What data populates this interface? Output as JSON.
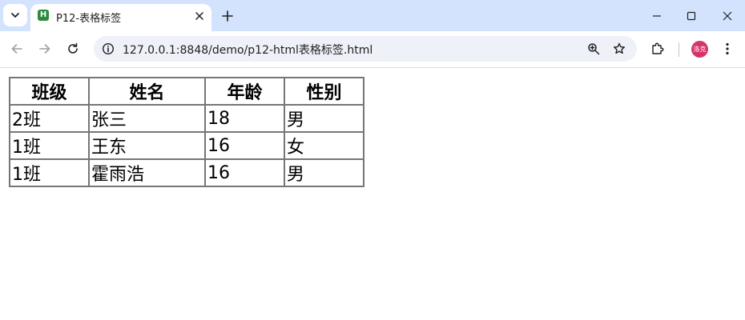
{
  "browser": {
    "tab": {
      "title": "P12-表格标签",
      "favicon_letter": "H"
    },
    "url": "127.0.0.1:8848/demo/p12-html表格标签.html",
    "profile_initials": "洛克",
    "icons": [
      "tab-search-icon",
      "close-icon",
      "plus-icon",
      "minimize-icon",
      "maximize-icon",
      "window-close-icon",
      "back-arrow-icon",
      "forward-arrow-icon",
      "reload-icon",
      "site-info-icon",
      "zoom-icon",
      "bookmark-star-icon",
      "extensions-icon",
      "menu-dots-icon"
    ],
    "colors": {
      "tabstrip": "#d3e3fd",
      "omnibox": "#eef1f8",
      "favicon": "#2b8a3e",
      "avatar": "#d6336c"
    }
  },
  "table": {
    "headers": [
      "班级",
      "姓名",
      "年龄",
      "性别"
    ],
    "rows": [
      [
        "2班",
        "张三",
        "18",
        "男"
      ],
      [
        "1班",
        "王东",
        "16",
        "女"
      ],
      [
        "1班",
        "霍雨浩",
        "16",
        "男"
      ]
    ]
  }
}
